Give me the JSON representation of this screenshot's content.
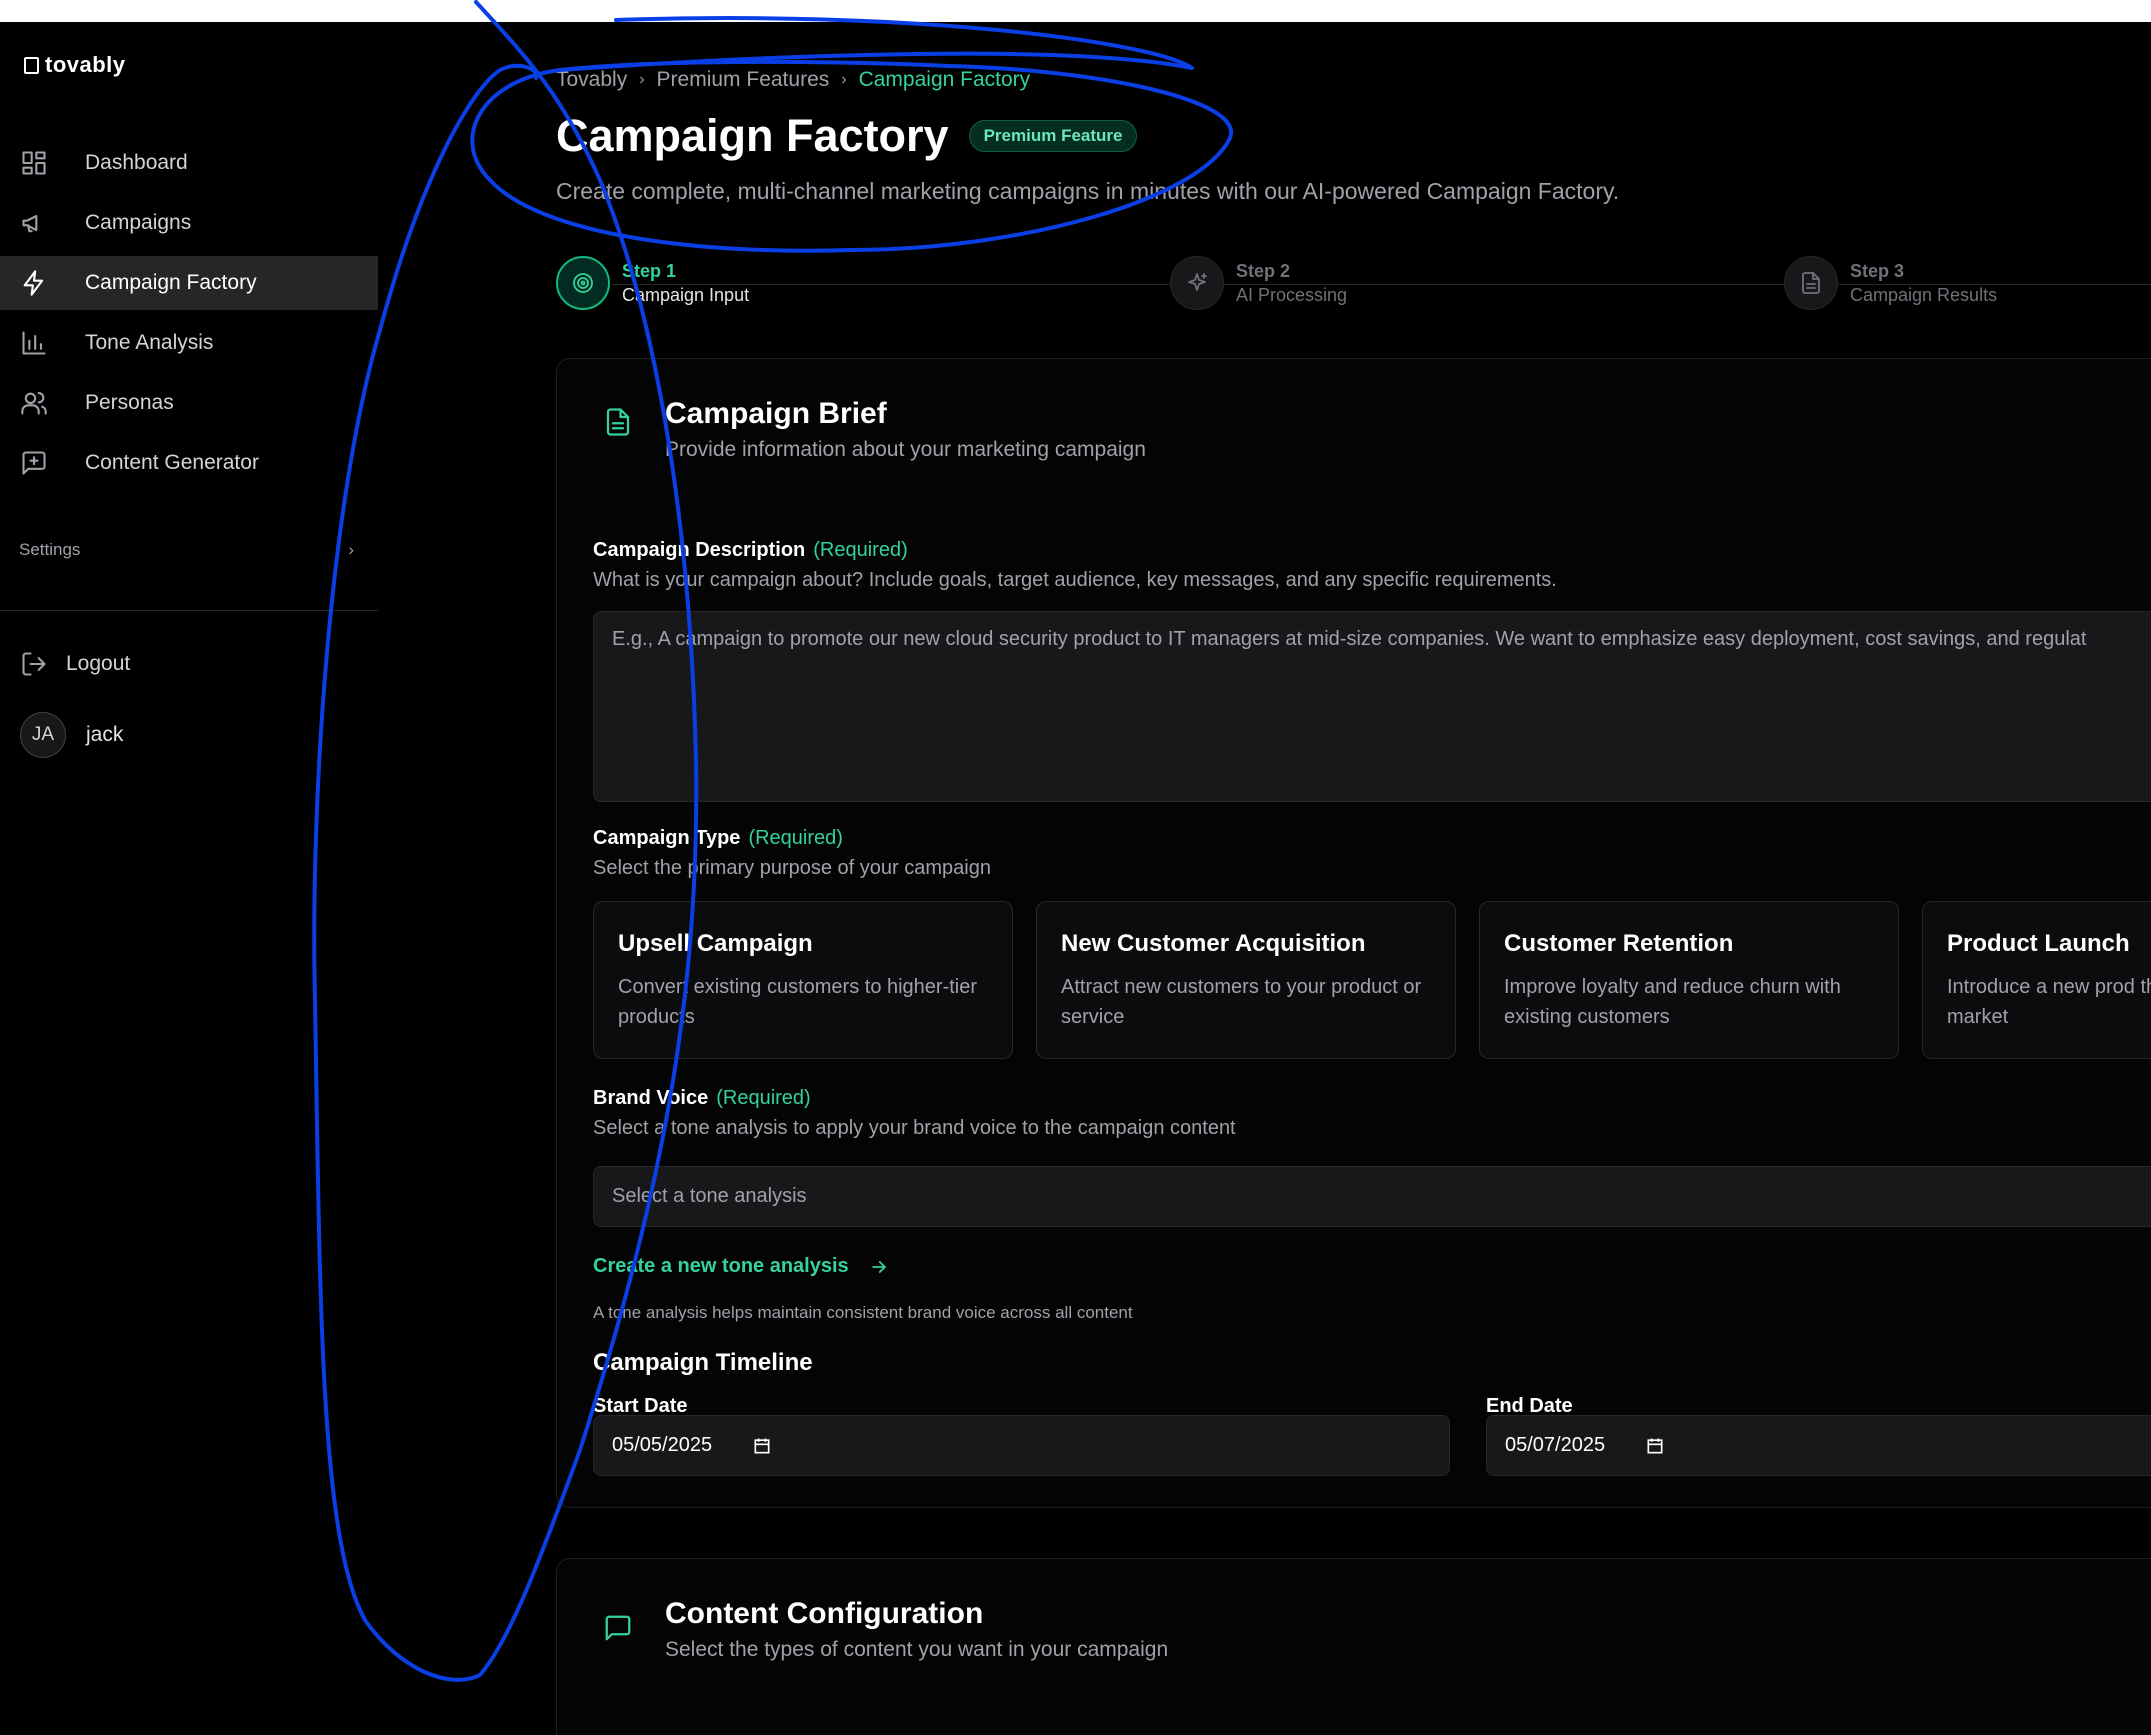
{
  "brand": {
    "name": "tovably",
    "accent": "#34d399"
  },
  "sidebar": {
    "items": [
      {
        "label": "Dashboard",
        "icon": "dashboard-icon",
        "active": false
      },
      {
        "label": "Campaigns",
        "icon": "megaphone-icon",
        "active": false
      },
      {
        "label": "Campaign Factory",
        "icon": "lightning-icon",
        "active": true
      },
      {
        "label": "Tone Analysis",
        "icon": "bar-chart-icon",
        "active": false
      },
      {
        "label": "Personas",
        "icon": "users-icon",
        "active": false
      },
      {
        "label": "Content Generator",
        "icon": "message-plus-icon",
        "active": false
      }
    ],
    "settings_label": "Settings",
    "logout_label": "Logout",
    "user": {
      "initials": "JA",
      "name": "jack"
    }
  },
  "breadcrumb": [
    "Tovably",
    "Premium Features",
    "Campaign Factory"
  ],
  "page": {
    "title": "Campaign Factory",
    "badge": "Premium Feature",
    "subtitle": "Create complete, multi-channel marketing campaigns in minutes with our AI-powered Campaign Factory."
  },
  "steps": [
    {
      "num": "Step 1",
      "name": "Campaign Input",
      "icon": "target-icon",
      "active": true
    },
    {
      "num": "Step 2",
      "name": "AI Processing",
      "icon": "sparkles-icon",
      "active": false
    },
    {
      "num": "Step 3",
      "name": "Campaign Results",
      "icon": "document-icon",
      "active": false
    }
  ],
  "brief": {
    "title": "Campaign Brief",
    "subtitle": "Provide information about your marketing campaign",
    "description": {
      "label": "Campaign Description",
      "required": "(Required)",
      "help": "What is your campaign about? Include goals, target audience, key messages, and any specific requirements.",
      "placeholder": "E.g., A campaign to promote our new cloud security product to IT managers at mid-size companies. We want to emphasize easy deployment, cost savings, and regulat"
    },
    "type": {
      "label": "Campaign Type",
      "required": "(Required)",
      "help": "Select the primary purpose of your campaign",
      "options": [
        {
          "title": "Upsell Campaign",
          "desc": "Convert existing customers to higher-tier products"
        },
        {
          "title": "New Customer Acquisition",
          "desc": "Attract new customers to your product or service"
        },
        {
          "title": "Customer Retention",
          "desc": "Improve loyalty and reduce churn with existing customers"
        },
        {
          "title": "Product Launch",
          "desc": "Introduce a new prod the market"
        }
      ]
    },
    "voice": {
      "label": "Brand Voice",
      "required": "(Required)",
      "help": "Select a tone analysis to apply your brand voice to the campaign content",
      "placeholder": "Select a tone analysis",
      "link": "Create a new tone analysis",
      "note": "A tone analysis helps maintain consistent brand voice across all content"
    },
    "timeline": {
      "title": "Campaign Timeline",
      "start_label": "Start Date",
      "start_value": "05/05/2025",
      "end_label": "End Date",
      "end_value": "05/07/2025"
    }
  },
  "content_config": {
    "title": "Content Configuration",
    "subtitle": "Select the types of content you want in your campaign"
  }
}
